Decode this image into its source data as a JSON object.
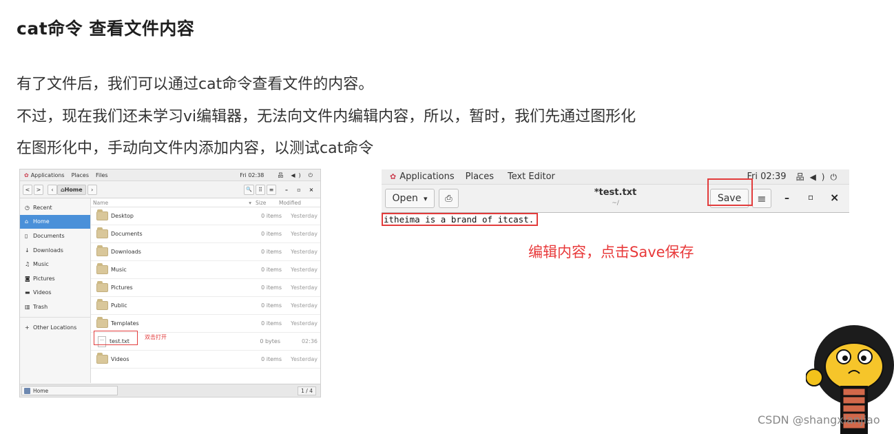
{
  "doc": {
    "title": "cat命令 查看文件内容",
    "paragraphs": [
      "有了文件后，我们可以通过cat命令查看文件的内容。",
      "不过，现在我们还未学习vi编辑器，无法向文件内编辑内容，所以，暂时，我们先通过图形化",
      "在图形化中，手动向文件内添加内容，以测试cat命令"
    ]
  },
  "files_window": {
    "topbar": {
      "applications": "Applications",
      "places": "Places",
      "files": "Files",
      "clock": "Fri 02:38"
    },
    "toolbar": {
      "back": "<",
      "forward": ">",
      "path_left": "‹",
      "home": "Home",
      "path_right": "›",
      "search": "🔍",
      "grid": "⠿",
      "menu": "≡",
      "minimize": "–",
      "maximize": "▫",
      "close": "×"
    },
    "sidebar": [
      {
        "icon": "◷",
        "label": "Recent"
      },
      {
        "icon": "⌂",
        "label": "Home"
      },
      {
        "icon": "▯",
        "label": "Documents"
      },
      {
        "icon": "↓",
        "label": "Downloads"
      },
      {
        "icon": "♫",
        "label": "Music"
      },
      {
        "icon": "◙",
        "label": "Pictures"
      },
      {
        "icon": "▬",
        "label": "Videos"
      },
      {
        "icon": "▥",
        "label": "Trash"
      },
      {
        "icon": "+",
        "label": "Other Locations"
      }
    ],
    "columns": {
      "name": "Name",
      "size": "Size",
      "modified": "Modified",
      "sort": "▾"
    },
    "rows": [
      {
        "name": "Desktop",
        "size": "0 items",
        "modified": "Yesterday"
      },
      {
        "name": "Documents",
        "size": "0 items",
        "modified": "Yesterday"
      },
      {
        "name": "Downloads",
        "size": "0 items",
        "modified": "Yesterday"
      },
      {
        "name": "Music",
        "size": "0 items",
        "modified": "Yesterday"
      },
      {
        "name": "Pictures",
        "size": "0 items",
        "modified": "Yesterday"
      },
      {
        "name": "Public",
        "size": "0 items",
        "modified": "Yesterday"
      },
      {
        "name": "Templates",
        "size": "0 items",
        "modified": "Yesterday"
      },
      {
        "name": "test.txt",
        "size": "0 bytes",
        "modified": "02:36"
      },
      {
        "name": "Videos",
        "size": "0 items",
        "modified": "Yesterday"
      }
    ],
    "annotation": "双击打开",
    "status": {
      "home": "Home",
      "page": "1 / 4"
    }
  },
  "editor_window": {
    "topbar": {
      "applications": "Applications",
      "places": "Places",
      "app": "Text Editor",
      "clock": "Fri 02:39"
    },
    "open_label": "Open",
    "open_arrow": "▾",
    "title": "*test.txt",
    "path": "~/",
    "save_label": "Save",
    "menu": "≡",
    "minimize": "–",
    "maximize": "▫",
    "close": "×",
    "content": "itheima is a brand of itcast.",
    "annotation": "编辑内容，点击Save保存"
  },
  "watermark": "CSDN @shangxianjiao",
  "colors": {
    "accent": "#4a90d9",
    "annotation": "#e8393a"
  }
}
